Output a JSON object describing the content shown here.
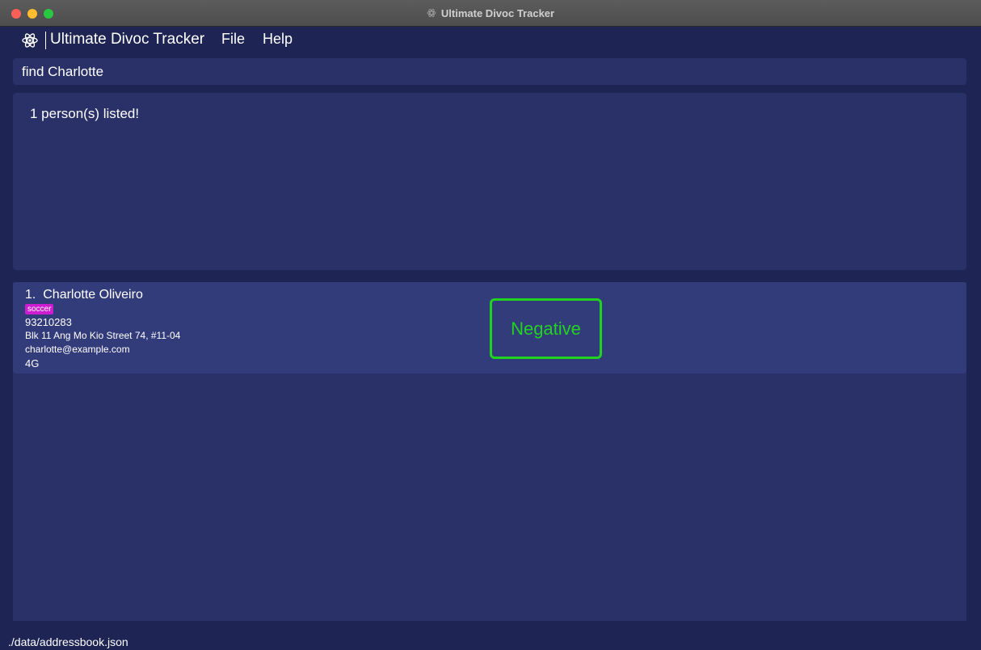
{
  "window": {
    "title": "Ultimate Divoc Tracker"
  },
  "menubar": {
    "app_name": "Ultimate Divoc Tracker",
    "app_icon": "atom-icon",
    "items": [
      {
        "label": "File"
      },
      {
        "label": "Help"
      }
    ]
  },
  "command": {
    "value": "find Charlotte"
  },
  "result": {
    "message": "1 person(s) listed!"
  },
  "persons": [
    {
      "index": "1.",
      "name": "Charlotte Oliveiro",
      "tags": [
        "soccer"
      ],
      "phone": "93210283",
      "address": "Blk 11 Ang Mo Kio Street 74, #11-04",
      "email": "charlotte@example.com",
      "vaccine": "4G",
      "status": "Negative"
    }
  ],
  "colors": {
    "background": "#1e2454",
    "panel": "#293168",
    "card": "#333c7a",
    "tag": "#cc1ed0",
    "status_negative": "#21d221"
  },
  "statusbar": {
    "path": "./data/addressbook.json"
  }
}
